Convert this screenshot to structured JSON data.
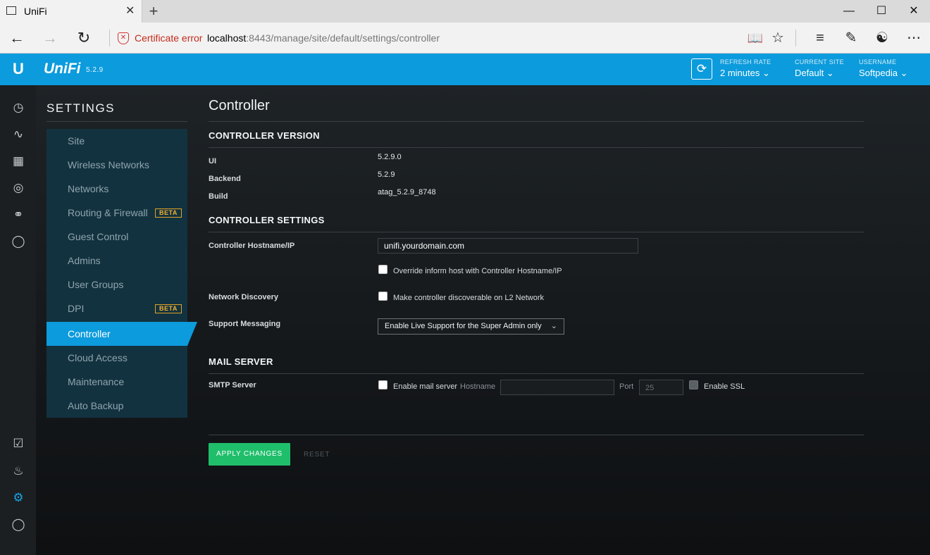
{
  "browser": {
    "tab_title": "UniFi",
    "tab_close": "✕",
    "new_tab": "+",
    "cert_error": "Certificate error",
    "url_host": "localhost",
    "url_path": ":8443/manage/site/default/settings/controller"
  },
  "header": {
    "logo_text": "UniFi",
    "version": "5.2.9",
    "refresh_rate_label": "REFRESH RATE",
    "refresh_rate_value": "2 minutes",
    "current_site_label": "CURRENT SITE",
    "current_site_value": "Default",
    "username_label": "USERNAME",
    "username_value": "Softpedia"
  },
  "sidebar": {
    "title": "SETTINGS",
    "items": [
      {
        "label": "Site"
      },
      {
        "label": "Wireless Networks"
      },
      {
        "label": "Networks"
      },
      {
        "label": "Routing & Firewall",
        "badge": "BETA"
      },
      {
        "label": "Guest Control"
      },
      {
        "label": "Admins"
      },
      {
        "label": "User Groups"
      },
      {
        "label": "DPI",
        "badge": "BETA"
      },
      {
        "label": "Controller"
      },
      {
        "label": "Cloud Access"
      },
      {
        "label": "Maintenance"
      },
      {
        "label": "Auto Backup"
      }
    ]
  },
  "page": {
    "title": "Controller",
    "version_section": "CONTROLLER VERSION",
    "ui_label": "UI",
    "ui_value": "5.2.9.0",
    "backend_label": "Backend",
    "backend_value": "5.2.9",
    "build_label": "Build",
    "build_value": "atag_5.2.9_8748",
    "settings_section": "CONTROLLER SETTINGS",
    "hostname_label": "Controller Hostname/IP",
    "hostname_value": "unifi.yourdomain.com",
    "override_label": "Override inform host with Controller Hostname/IP",
    "discovery_label": "Network Discovery",
    "discovery_checkbox": "Make controller discoverable on L2 Network",
    "support_label": "Support Messaging",
    "support_value": "Enable Live Support for the Super Admin only",
    "mail_section": "MAIL SERVER",
    "smtp_label": "SMTP Server",
    "enable_mail": "Enable mail server",
    "hostname_field_label": "Hostname",
    "port_label": "Port",
    "port_placeholder": "25",
    "enable_ssl": "Enable SSL",
    "apply": "APPLY CHANGES",
    "reset": "RESET"
  }
}
